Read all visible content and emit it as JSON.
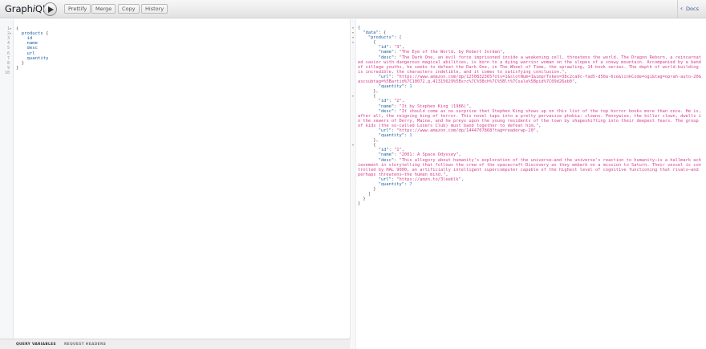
{
  "app": {
    "title_plain": "Graph",
    "title_italic": "i",
    "title_end": "QL"
  },
  "toolbar": {
    "execute_icon": "play-icon",
    "buttons": [
      "Prettify",
      "Merge",
      "Copy",
      "History"
    ]
  },
  "docs": {
    "label": "Docs",
    "icon": "chevron-left-icon"
  },
  "query": {
    "lines": [
      "{",
      "  products {",
      "    id",
      "    name",
      "    desc",
      "    url",
      "    quantity",
      "  }",
      "}",
      ""
    ],
    "line_numbers": [
      "1",
      "2",
      "3",
      "4",
      "5",
      "6",
      "7",
      "8",
      "9",
      "10"
    ]
  },
  "variables_bar": {
    "tabs": [
      "QUERY VARIABLES",
      "REQUEST HEADERS"
    ]
  },
  "result": {
    "products": [
      {
        "id": "3",
        "name": "The Eye of the World, by Robert Jordan",
        "desc": "The Dark One, an evil force imprisoned inside a weakening cell, threatens the world. The Dragon Reborn, a reincarnated savior with dangerous magical abilities, is born to a dying warrior woman on the slopes of a snowy mountain. Accompanied by a band of village youths, he seeks to defeat the Dark One, in The Wheel of Time, the sprawling, 14-book series. The depth of world-building is incredible, the characters indelible, and it comes to satisfying conclusion.",
        "url": "https://www.amazon.com/dp/1250832365?ots=1&slotNum=1&imprToken=38c2ca9c-fad5-d50a-6ce&linkCode=ogi&tag=oprah-auto-20&ascsubtag=%5Bartid%7C10072.g.41315629%5Bsrc%7C%5Bch%7C%5Blt%7Csale%5Bpid%7C09d26eb0",
        "quantity": "1"
      },
      {
        "id": "2",
        "name": "It by Stephen King (1986)",
        "desc": "It should come as no surprise that Stephen King shows up on this list of the top horror books more than once. He is, after all, the reigning king of terror. This novel taps into a pretty pervasive phobia: clowns. Pennywise, the killer clown, dwells in the sewers of Derry, Maine, and he preys upon the young residents of the town by shapeshifting into their deepest fears. The group of kids (the so-called Losers Club) must band together to defeat him.",
        "url": "https://www.amazon.com/dp/1444707868?tag=readerwp-20",
        "quantity": "1"
      },
      {
        "id": "1",
        "name": "2001: A Space Odyssey",
        "desc": "This allegory about humanity's exploration of the universe—and the universe's reaction to humanity—is a hallmark achievement in storytelling that follows the crew of the spacecraft Discovery as they embark on a mission to Saturn. Their vessel is controlled by HAL 9000, an artificially intelligent supercomputer capable of the highest level of cognitive functioning that rivals—and perhaps threatens—the human mind.",
        "url": "https://amzn.to/3leeblk",
        "quantity": "7"
      }
    ]
  },
  "colors": {
    "key": "#1f61a0",
    "string": "#d64292",
    "number": "#2882f9",
    "link": "#3b5998"
  }
}
